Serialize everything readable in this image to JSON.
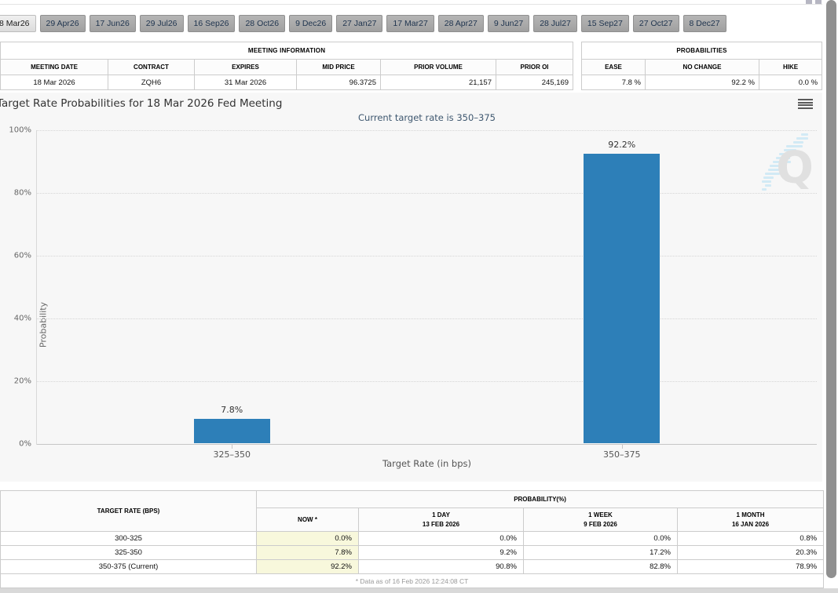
{
  "tabs": {
    "items": [
      {
        "label": "8 Mar26",
        "active": true
      },
      {
        "label": "29 Apr26",
        "active": false
      },
      {
        "label": "17 Jun26",
        "active": false
      },
      {
        "label": "29 Jul26",
        "active": false
      },
      {
        "label": "16 Sep26",
        "active": false
      },
      {
        "label": "28 Oct26",
        "active": false
      },
      {
        "label": "9 Dec26",
        "active": false
      },
      {
        "label": "27 Jan27",
        "active": false
      },
      {
        "label": "17 Mar27",
        "active": false
      },
      {
        "label": "28 Apr27",
        "active": false
      },
      {
        "label": "9 Jun27",
        "active": false
      },
      {
        "label": "28 Jul27",
        "active": false
      },
      {
        "label": "15 Sep27",
        "active": false
      },
      {
        "label": "27 Oct27",
        "active": false
      },
      {
        "label": "8 Dec27",
        "active": false
      }
    ]
  },
  "meeting_information": {
    "title": "MEETING INFORMATION",
    "columns": [
      "MEETING DATE",
      "CONTRACT",
      "EXPIRES",
      "MID PRICE",
      "PRIOR VOLUME",
      "PRIOR OI"
    ],
    "values": [
      "18 Mar 2026",
      "ZQH6",
      "31 Mar 2026",
      "96.3725",
      "21,157",
      "245,169"
    ]
  },
  "probabilities": {
    "title": "PROBABILITIES",
    "columns": [
      "EASE",
      "NO CHANGE",
      "HIKE"
    ],
    "values": [
      "7.8 %",
      "92.2 %",
      "0.0 %"
    ]
  },
  "chart_data": {
    "type": "bar",
    "title": "Target Rate Probabilities for 18 Mar 2026 Fed Meeting",
    "subtitle": "Current target rate is 350–375",
    "categories": [
      "325–350",
      "350–375"
    ],
    "values": [
      7.8,
      92.2
    ],
    "value_labels": [
      "7.8%",
      "92.2%"
    ],
    "xlabel": "Target Rate (in bps)",
    "ylabel": "Probability",
    "ylim": [
      0,
      100
    ],
    "yticks": [
      "0%",
      "20%",
      "40%",
      "60%",
      "80%",
      "100%"
    ],
    "grid": "dotted-horizontal",
    "legend": "none",
    "bar_color": "#2d7fb8"
  },
  "history_table": {
    "col1_header": "TARGET RATE (BPS)",
    "group_header": "PROBABILITY(%)",
    "sub_headers": [
      {
        "line1": "NOW *",
        "line2": ""
      },
      {
        "line1": "1 DAY",
        "line2": "13 FEB 2026"
      },
      {
        "line1": "1 WEEK",
        "line2": "9 FEB 2026"
      },
      {
        "line1": "1 MONTH",
        "line2": "16 JAN 2026"
      }
    ],
    "rows": [
      [
        "300-325",
        "0.0%",
        "0.0%",
        "0.0%",
        "0.8%"
      ],
      [
        "325-350",
        "7.8%",
        "9.2%",
        "17.2%",
        "20.3%"
      ],
      [
        "350-375 (Current)",
        "92.2%",
        "90.8%",
        "82.8%",
        "78.9%"
      ]
    ],
    "footnote": "* Data as of 16 Feb 2026 12:24:08 CT"
  },
  "colors": {
    "bar": "#2d7fb8",
    "now_column_highlight": "#f8f8dc",
    "tab_text": "#20354f",
    "chart_background": "#f7f7f7"
  },
  "icons": {
    "chart_menu": "hamburger-menu",
    "watermark": "quikstrike-q-logo"
  }
}
